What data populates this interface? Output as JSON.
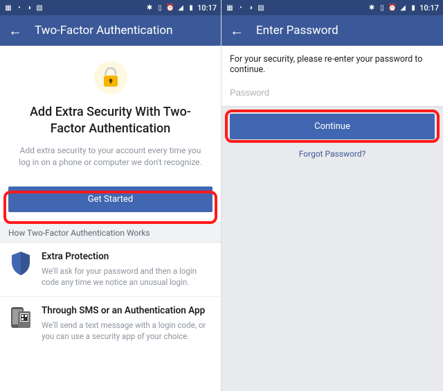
{
  "status": {
    "time": "10:17"
  },
  "left": {
    "appbar_title": "Two-Factor Authentication",
    "hero_title": "Add Extra Security With Two-Factor Authentication",
    "hero_sub": "Add extra security to your account every time you log in on a phone or computer we don't recognize.",
    "get_started": "Get Started",
    "section_header": "How Two-Factor Authentication Works",
    "items": [
      {
        "title": "Extra Protection",
        "desc": "We'll ask for your password and then a login code any time we notice an unusual login."
      },
      {
        "title": "Through SMS or an Authentication App",
        "desc": "We'll send a text message with a login code, or you can use a security app of your choice."
      }
    ]
  },
  "right": {
    "appbar_title": "Enter Password",
    "message": "For your security, please re-enter your password to continue.",
    "placeholder": "Password",
    "continue": "Continue",
    "forgot": "Forgot Password?"
  }
}
